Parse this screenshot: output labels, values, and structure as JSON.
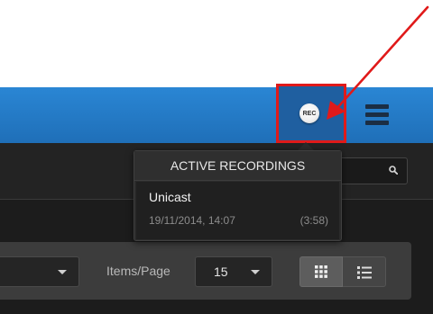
{
  "header": {
    "rec_button_label": "REC",
    "menu_icon": "hamburger-menu-icon",
    "accent_color": "#1f6fb8",
    "highlight_color": "#e01a1a"
  },
  "search": {
    "placeholder": "",
    "icon": "search-icon"
  },
  "active_recordings": {
    "title": "ACTIVE RECORDINGS",
    "items": [
      {
        "name": "Unicast",
        "date": "19/11/2014, 14:07",
        "duration": "(3:58)"
      }
    ]
  },
  "toolbar": {
    "category_value": "",
    "items_per_page_label": "Items/Page",
    "items_per_page_value": "15",
    "view_modes": [
      "grid",
      "list"
    ],
    "selected_view": "grid"
  }
}
